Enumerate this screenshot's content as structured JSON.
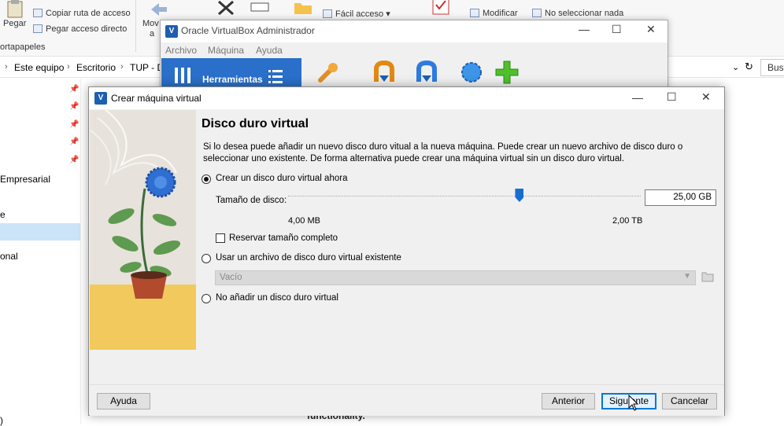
{
  "explorer": {
    "ribbon": {
      "pegar": "Pegar",
      "copiar_ruta": "Copiar ruta de acceso",
      "pegar_acceso": "Pegar acceso directo",
      "portapapeles": "ortapapeles",
      "mover": "Mov",
      "mover2": "a",
      "facil_acceso": "Fácil acceso",
      "modificar": "Modificar",
      "no_seleccionar": "No seleccionar nada"
    },
    "breadcrumb": [
      "Este equipo",
      "Escritorio",
      "TUP - D"
    ],
    "search_placeholder": "Bus",
    "left_items": [
      "Empresarial",
      "e",
      "onal"
    ],
    "bottom_left": ")",
    "funct_text": "functionality."
  },
  "manager": {
    "title": "Oracle VirtualBox Administrador",
    "menu": [
      "Archivo",
      "Máquina",
      "Ayuda"
    ],
    "tools_label": "Herramientas"
  },
  "dialog": {
    "title": "Crear máquina virtual",
    "heading": "Disco duro virtual",
    "description": "Si lo desea puede añadir un nuevo disco duro vitual a la nueva máquina. Puede crear un nuevo archivo de disco duro o seleccionar uno existente. De forma alternativa puede crear una máquina virtual sin un disco duro virtual.",
    "option_create": "Crear un disco duro virtual ahora",
    "size_label": "Tamaño de disco:",
    "size_value": "25,00 GB",
    "slider_fraction": 0.655,
    "min_label": "4,00 MB",
    "max_label": "2,00 TB",
    "reserve_label": "Reservar tamaño completo",
    "option_existing": "Usar un archivo de disco duro virtual existente",
    "existing_value": "Vacío",
    "option_none": "No añadir un disco duro virtual",
    "buttons": {
      "help": "Ayuda",
      "back": "Anterior",
      "next": "Siguiente",
      "cancel": "Cancelar"
    }
  },
  "colors": {
    "accent": "#0078d7",
    "slider": "#1a6dd0",
    "tools_bg": "#2a6fc9"
  }
}
